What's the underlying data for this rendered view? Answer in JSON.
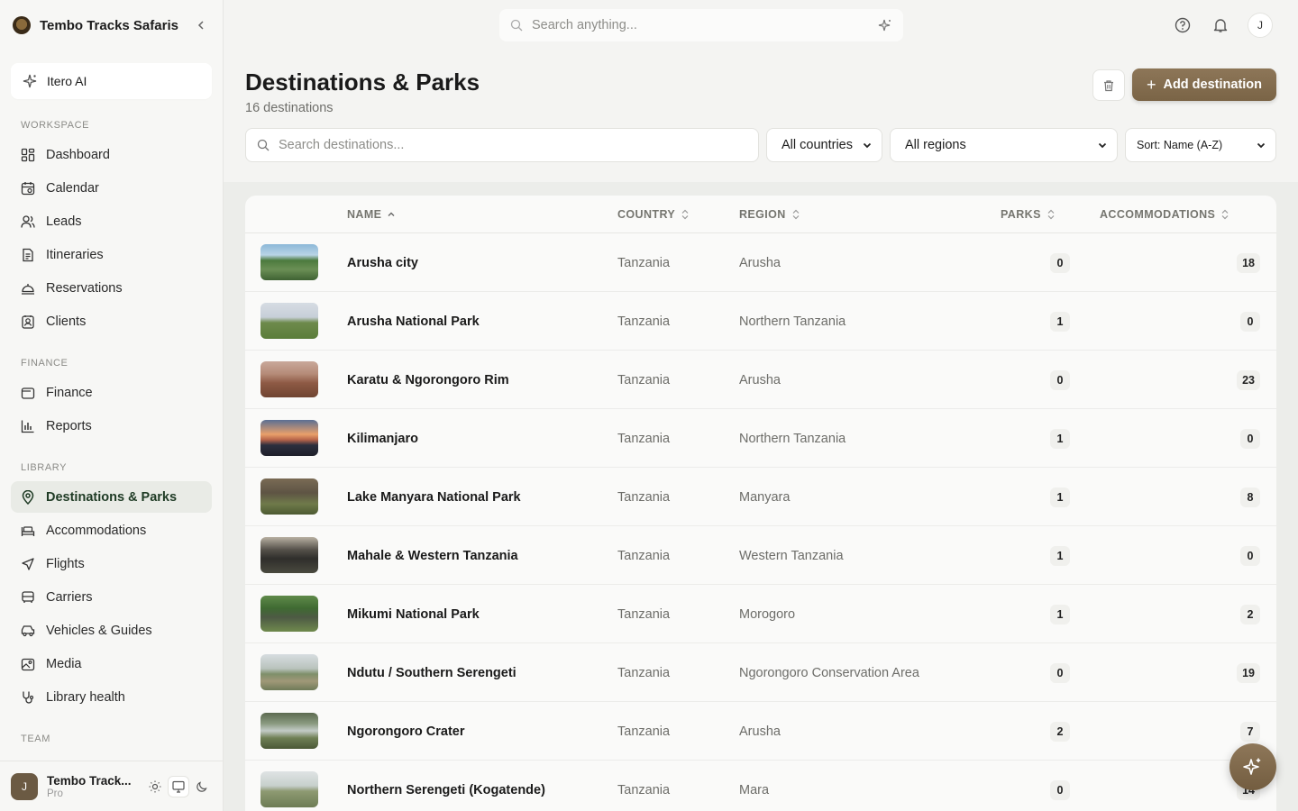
{
  "brand": {
    "name": "Tembo Tracks Safaris"
  },
  "sidebar": {
    "ai_label": "Itero AI",
    "sections": {
      "workspace": "WORKSPACE",
      "finance": "FINANCE",
      "library": "LIBRARY",
      "team": "TEAM"
    },
    "workspace_items": [
      {
        "label": "Dashboard",
        "icon": "dashboard-icon"
      },
      {
        "label": "Calendar",
        "icon": "calendar-icon"
      },
      {
        "label": "Leads",
        "icon": "users-icon"
      },
      {
        "label": "Itineraries",
        "icon": "document-icon"
      },
      {
        "label": "Reservations",
        "icon": "bell-desk-icon"
      },
      {
        "label": "Clients",
        "icon": "contact-icon"
      }
    ],
    "finance_items": [
      {
        "label": "Finance",
        "icon": "wallet-icon"
      },
      {
        "label": "Reports",
        "icon": "bar-chart-icon"
      }
    ],
    "library_items": [
      {
        "label": "Destinations & Parks",
        "icon": "map-pin-icon",
        "active": true
      },
      {
        "label": "Accommodations",
        "icon": "bed-icon"
      },
      {
        "label": "Flights",
        "icon": "plane-icon"
      },
      {
        "label": "Carriers",
        "icon": "bus-icon"
      },
      {
        "label": "Vehicles & Guides",
        "icon": "car-icon"
      },
      {
        "label": "Media",
        "icon": "image-icon"
      },
      {
        "label": "Library health",
        "icon": "stethoscope-icon"
      }
    ],
    "footer": {
      "avatar": "J",
      "name": "Tembo Track...",
      "plan": "Pro"
    }
  },
  "topbar": {
    "search_placeholder": "Search anything...",
    "user_initial": "J"
  },
  "page": {
    "title": "Destinations & Parks",
    "subtitle": "16 destinations",
    "add_label": "Add destination"
  },
  "filters": {
    "search_placeholder": "Search destinations...",
    "country": "All countries",
    "region": "All regions",
    "sort": "Sort: Name (A-Z)"
  },
  "table": {
    "columns": {
      "name": "NAME",
      "country": "COUNTRY",
      "region": "REGION",
      "parks": "PARKS",
      "accommodations": "ACCOMMODATIONS"
    },
    "rows": [
      {
        "name": "Arusha city",
        "country": "Tanzania",
        "region": "Arusha",
        "parks": "0",
        "accommodations": "18"
      },
      {
        "name": "Arusha National Park",
        "country": "Tanzania",
        "region": "Northern Tanzania",
        "parks": "1",
        "accommodations": "0"
      },
      {
        "name": "Karatu & Ngorongoro Rim",
        "country": "Tanzania",
        "region": "Arusha",
        "parks": "0",
        "accommodations": "23"
      },
      {
        "name": "Kilimanjaro",
        "country": "Tanzania",
        "region": "Northern Tanzania",
        "parks": "1",
        "accommodations": "0"
      },
      {
        "name": "Lake Manyara National Park",
        "country": "Tanzania",
        "region": "Manyara",
        "parks": "1",
        "accommodations": "8"
      },
      {
        "name": "Mahale & Western Tanzania",
        "country": "Tanzania",
        "region": "Western Tanzania",
        "parks": "1",
        "accommodations": "0"
      },
      {
        "name": "Mikumi National Park",
        "country": "Tanzania",
        "region": "Morogoro",
        "parks": "1",
        "accommodations": "2"
      },
      {
        "name": "Ndutu / Southern Serengeti",
        "country": "Tanzania",
        "region": "Ngorongoro Conservation Area",
        "parks": "0",
        "accommodations": "19"
      },
      {
        "name": "Ngorongoro Crater",
        "country": "Tanzania",
        "region": "Arusha",
        "parks": "2",
        "accommodations": "7"
      },
      {
        "name": "Northern Serengeti (Kogatende)",
        "country": "Tanzania",
        "region": "Mara",
        "parks": "0",
        "accommodations": "14"
      }
    ]
  },
  "colors": {
    "accent": "#7f6849",
    "active_nav_bg": "#e9ebe6"
  }
}
